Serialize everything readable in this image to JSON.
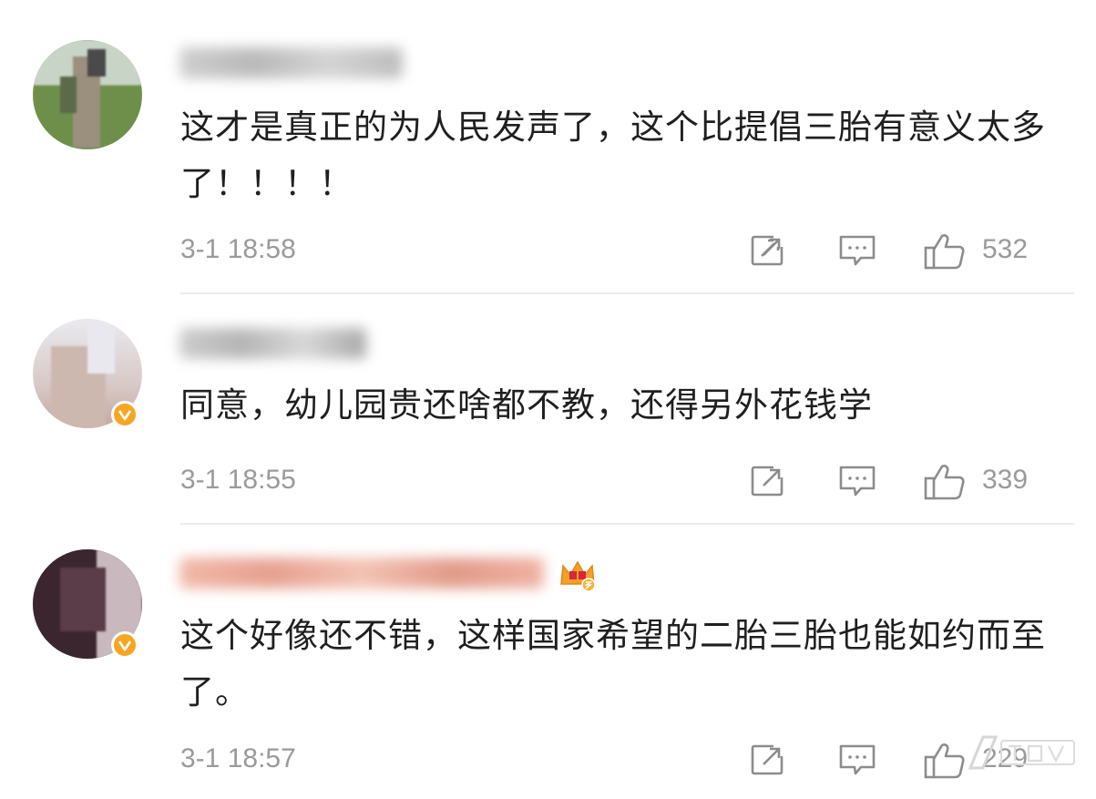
{
  "colors": {
    "text": "#1f1f1f",
    "meta": "#9a9a9a",
    "verified_badge": "#f6a623",
    "divider": "#ececec"
  },
  "icons": {
    "repost": "repost-icon",
    "comment": "comment-icon",
    "like": "thumbs-up-icon",
    "verified": "verified-v-icon",
    "membership": "crown-membership-icon"
  },
  "comments": [
    {
      "text": "这才是真正的为人民发声了，这个比提倡三胎有意义太多了！！！！",
      "time": "3-1 18:58",
      "likes": "532",
      "verified": false
    },
    {
      "text": "同意，幼儿园贵还啥都不教，还得另外花钱学",
      "time": "3-1 18:55",
      "likes": "339",
      "verified": true
    },
    {
      "text": "这个好像还不错，这样国家希望的二胎三胎也能如约而至了。",
      "time": "3-1 18:57",
      "likes": "229",
      "verified": true
    }
  ]
}
